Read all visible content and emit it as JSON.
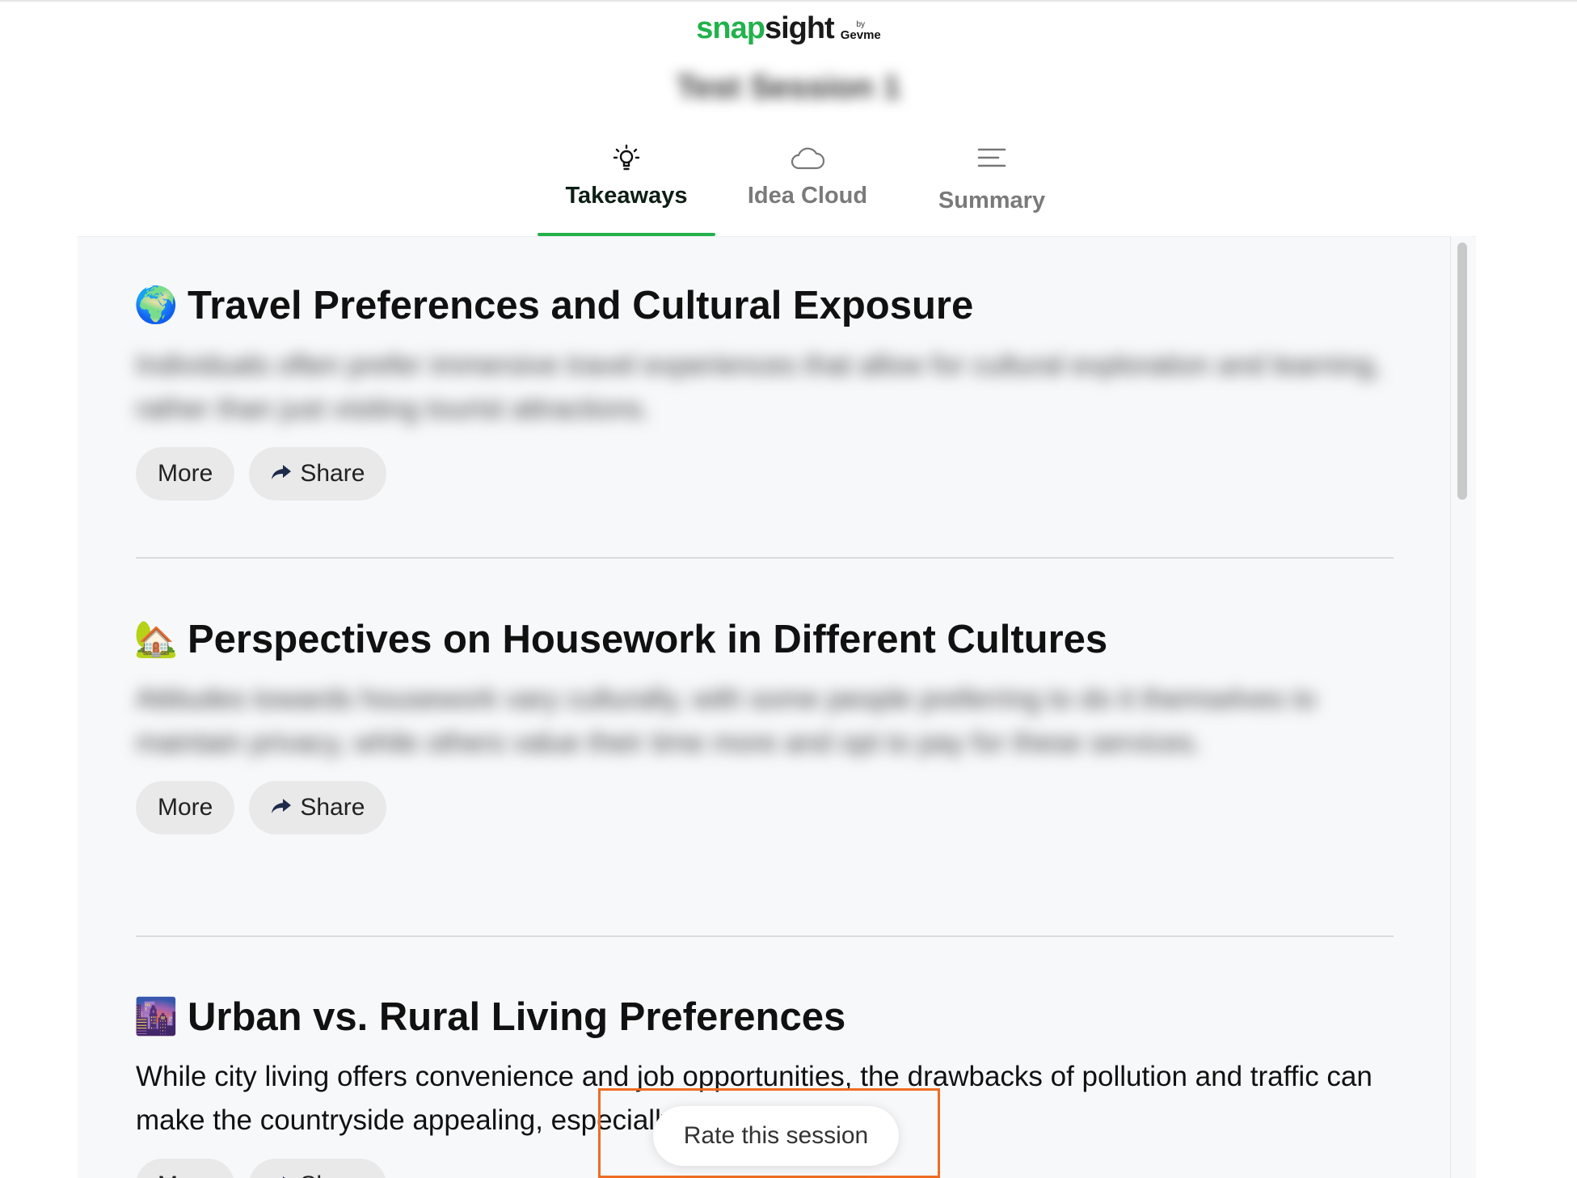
{
  "logo": {
    "part1": "snap",
    "part2": "sight",
    "by": "by",
    "brand": "Gevme"
  },
  "session": {
    "title": "Test Session 1"
  },
  "tabs": [
    {
      "label": "Takeaways",
      "icon": "lightbulb-icon",
      "active": true
    },
    {
      "label": "Idea Cloud",
      "icon": "cloud-icon",
      "active": false
    },
    {
      "label": "Summary",
      "icon": "menu-lines-icon",
      "active": false
    }
  ],
  "takeaways": [
    {
      "emoji": "🌍",
      "title": "Travel Preferences and Cultural Exposure",
      "description": "Individuals often prefer immersive travel experiences that allow for cultural exploration and learning, rather than just visiting tourist attractions.",
      "blurred": true,
      "more_label": "More",
      "share_label": "Share"
    },
    {
      "emoji": "🏡",
      "title": "Perspectives on Housework in Different Cultures",
      "description": "Attitudes towards housework vary culturally, with some people preferring to do it themselves to maintain privacy, while others value their time more and opt to pay for these services.",
      "blurred": true,
      "more_label": "More",
      "share_label": "Share"
    },
    {
      "emoji": "🌆",
      "title": "Urban vs. Rural Living Preferences",
      "description": "While city living offers convenience and job opportunities, the drawbacks of pollution and traffic can make the countryside appealing, especially for retirement.",
      "blurred": false,
      "more_label": "More",
      "share_label": "Share"
    }
  ],
  "rate": {
    "label": "Rate this session"
  },
  "colors": {
    "brand_green": "#22b24c",
    "highlight_orange": "#ef6c22",
    "panel_bg": "#f7f8fa"
  }
}
